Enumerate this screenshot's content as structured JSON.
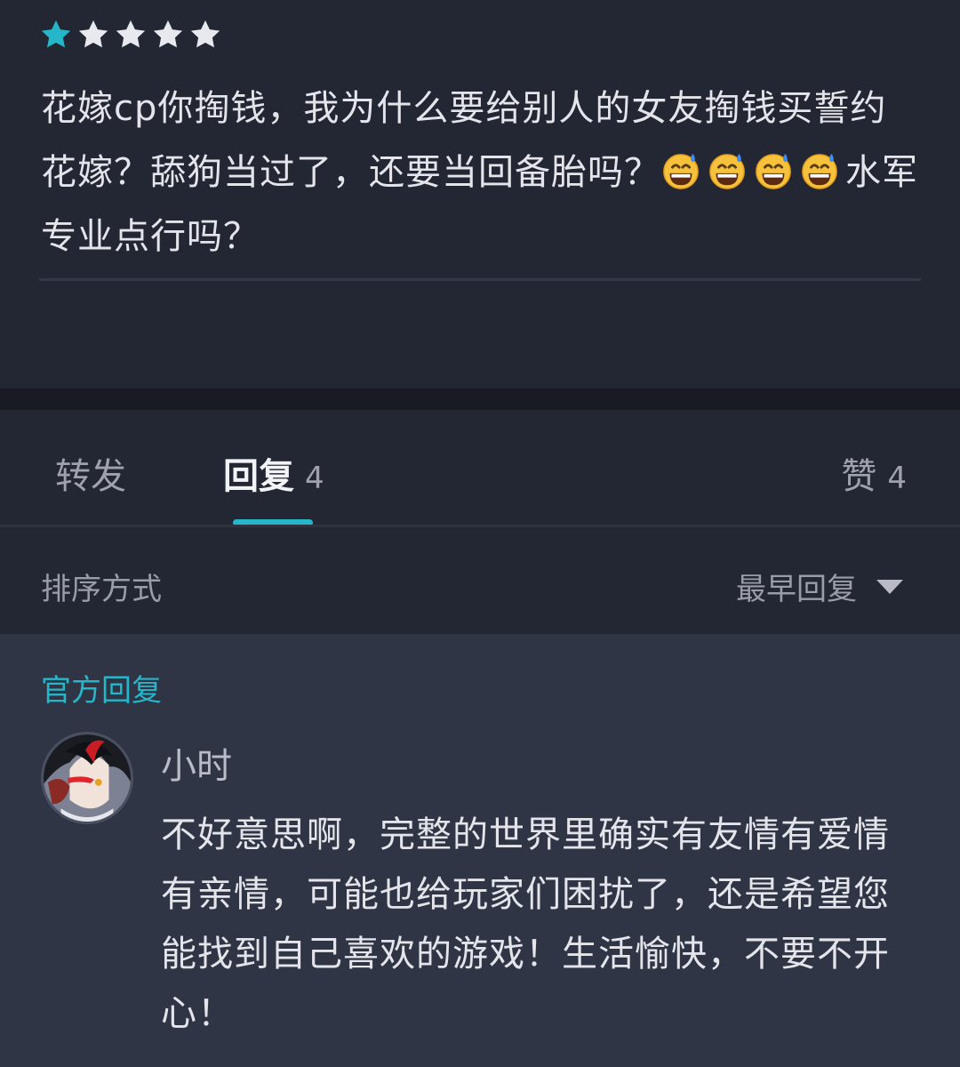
{
  "review": {
    "rating": 1,
    "max_rating": 5,
    "text_part1": "花嫁cp你掏钱，我为什么要给别人的女友掏钱买誓约花嫁？舔狗当过了，还要当回备胎吗？",
    "emoji_name": "grinning-sweat-emoji",
    "emoji_count": 4,
    "text_part2": "水军专业点行吗？"
  },
  "tabs": {
    "forward_label": "转发",
    "reply_label": "回复",
    "reply_count": "4",
    "like_label": "赞",
    "like_count": "4",
    "active": "reply"
  },
  "sort": {
    "label": "排序方式",
    "selected": "最早回复"
  },
  "official_reply": {
    "section_label": "官方回复",
    "author": "小时",
    "text": "不好意思啊，完整的世界里确实有友情有爱情有亲情，可能也给玩家们困扰了，还是希望您能找到自己喜欢的游戏！生活愉快，不要不开心！"
  },
  "colors": {
    "accent": "#25b6c9",
    "background": "#232633",
    "official_background": "#303545",
    "star_filled": "#25b6c9",
    "star_empty": "#e8e9ee"
  }
}
